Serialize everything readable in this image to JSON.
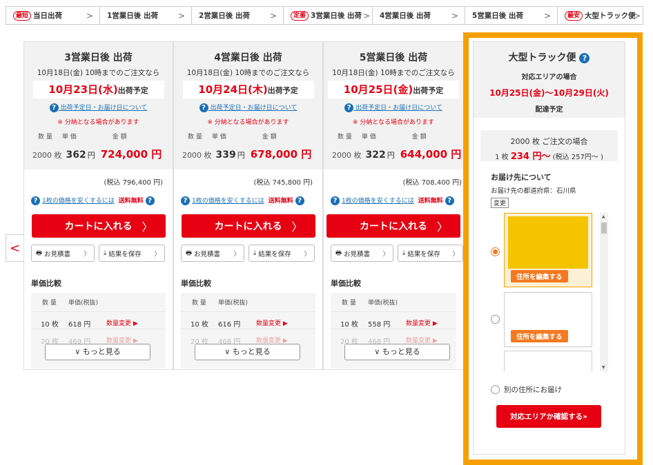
{
  "tabs": [
    {
      "badge": "最短",
      "label": "当日出荷"
    },
    {
      "badge": "",
      "label": "1営業日後 出荷"
    },
    {
      "badge": "",
      "label": "2営業日後 出荷"
    },
    {
      "badge": "定番",
      "label": "3営業日後 出荷"
    },
    {
      "badge": "",
      "label": "4営業日後 出荷"
    },
    {
      "badge": "",
      "label": "5営業日後 出荷"
    },
    {
      "badge": "最安",
      "label": "大型トラック便"
    }
  ],
  "chevron": ">",
  "columns": [
    {
      "title": "3営業日後 出荷",
      "cutoff": "10月18日(金) 10時までのご注文なら",
      "ship_date": "10月23日(水)",
      "ship_label": "出荷予定",
      "unit": "362",
      "total": "724,000 円",
      "tax_incl": "(税込 796,400 円)",
      "compare": [
        {
          "q": "10 枚",
          "p": "618 円"
        },
        {
          "q": "20 枚",
          "p": "469 円"
        }
      ]
    },
    {
      "title": "4営業日後 出荷",
      "cutoff": "10月18日(金) 10時までのご注文なら",
      "ship_date": "10月24日(木)",
      "ship_label": "出荷予定",
      "unit": "339",
      "total": "678,000 円",
      "tax_incl": "(税込 745,800 円)",
      "compare": [
        {
          "q": "10 枚",
          "p": "616 円"
        },
        {
          "q": "20 枚",
          "p": "468 円"
        }
      ]
    },
    {
      "title": "5営業日後 出荷",
      "cutoff": "10月18日(金) 10時までのご注文なら",
      "ship_date": "10月25日(金)",
      "ship_label": "出荷予定",
      "unit": "322",
      "total": "644,000 円",
      "tax_incl": "(税込 708,400 円)",
      "compare": [
        {
          "q": "10 枚",
          "p": "558 円"
        },
        {
          "q": "20 枚",
          "p": "468 円"
        }
      ]
    }
  ],
  "common": {
    "info_link": "出荷予定日・お届け日について",
    "partial_note": "※ 分納となる場合があります",
    "col_qty": "数 量",
    "col_unit": "単 価",
    "col_amount": "金 額",
    "qty": "2000 枚",
    "yen": "円",
    "cheaper_link": "1枚の価格を安くするには",
    "free_shipping": "送料無料",
    "cart_button": "カートに入れる",
    "quote_button": "お見積書",
    "save_button": "結果を保存",
    "compare_title": "単価比較",
    "cmp_qty": "数 量",
    "cmp_unit": "単価(税抜)",
    "change_qty": "数量変更 ▶",
    "more_button": "∨ もっと見る"
  },
  "truck": {
    "title": "大型トラック便",
    "area": "対応エリアの場合",
    "period": "10月25日(金)〜10月29日(火)",
    "delivery": "配達予定",
    "price_line1": "2000 枚 ご注文の場合",
    "price_prefix": "1 枚",
    "price_red": "234 円〜",
    "price_tax": "(税込 257円〜 )",
    "dest_title": "お届け先について",
    "dest_pref": "お届け先の都道府県：石川県",
    "change": "変更",
    "edit_address": "住所を編集する",
    "other_address": "別の住所にお届け",
    "confirm_button": "対応エリアか確認する"
  },
  "colors": {
    "accent": "#e60012",
    "orange": "#f5a000",
    "edit": "#f47920",
    "link": "#1a6fb5"
  }
}
